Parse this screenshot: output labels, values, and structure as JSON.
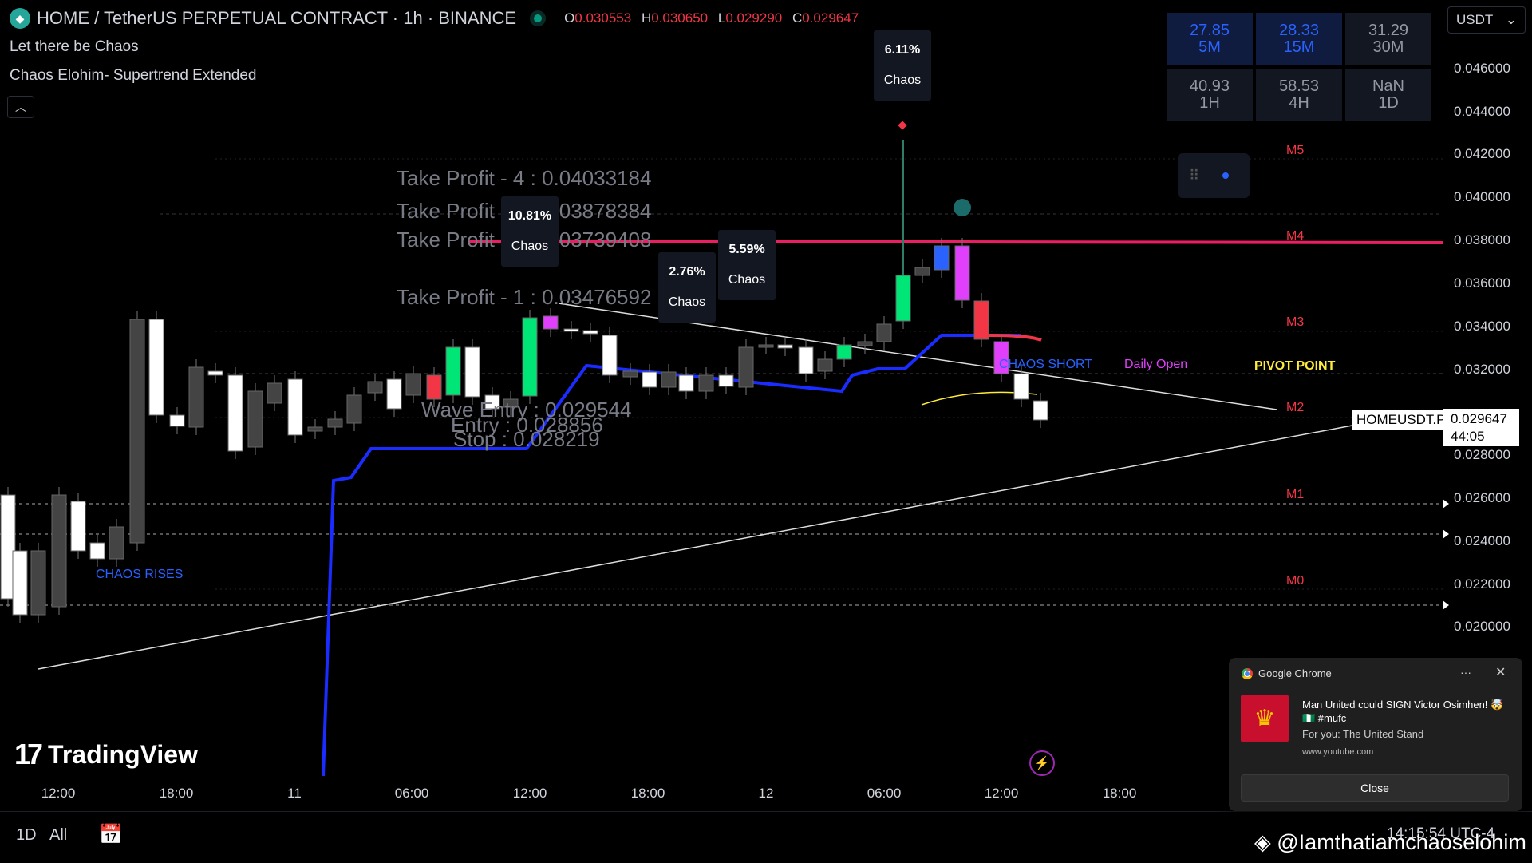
{
  "header": {
    "symbol_title": "HOME / TetherUS PERPETUAL CONTRACT · 1h · BINANCE",
    "ohlc": {
      "o_label": "O",
      "o": "0.030553",
      "h_label": "H",
      "h": "0.030650",
      "l_label": "L",
      "l": "0.029290",
      "c_label": "C",
      "c": "0.029647"
    }
  },
  "indicators": [
    "Let there be Chaos",
    "Chaos Elohim- Supertrend Extended"
  ],
  "currency": "USDT",
  "tf_table": [
    {
      "val": "27.85",
      "tf": "5M"
    },
    {
      "val": "28.33",
      "tf": "15M"
    },
    {
      "val": "31.29",
      "tf": "30M"
    },
    {
      "val": "40.93",
      "tf": "1H"
    },
    {
      "val": "58.53",
      "tf": "4H"
    },
    {
      "val": "NaN",
      "tf": "1D"
    }
  ],
  "y_axis": [
    "0.046000",
    "0.044000",
    "0.042000",
    "0.040000",
    "0.038000",
    "0.036000",
    "0.034000",
    "0.032000",
    "0.028000",
    "0.026000",
    "0.024000",
    "0.022000",
    "0.020000"
  ],
  "price_tag": {
    "symbol": "HOMEUSDT.P",
    "price": "0.029647",
    "countdown": "44:05"
  },
  "x_axis": [
    "12:00",
    "18:00",
    "11",
    "06:00",
    "12:00",
    "18:00",
    "12",
    "06:00",
    "12:00",
    "18:00"
  ],
  "take_profits": [
    "Take Profit - 4 : 0.04033184",
    "Take Profit - 3 : 0.03878384",
    "Take Profit - 2 : 0.03739408",
    "Take Profit - 1 : 0.03476592"
  ],
  "entries": [
    "Wave Entry : 0.029544",
    "Entry : 0.028856",
    "Stop : 0.028219"
  ],
  "bubbles": [
    {
      "pct": "10.81%",
      "label": "Chaos"
    },
    {
      "pct": "2.76%",
      "label": "Chaos"
    },
    {
      "pct": "5.59%",
      "label": "Chaos"
    },
    {
      "pct": "6.11%",
      "label": "Chaos"
    }
  ],
  "levels": [
    "M5",
    "M4",
    "M3",
    "M2",
    "M1",
    "M0"
  ],
  "labels": {
    "chaos_short": "CHAOS SHORT",
    "daily_open": "Daily Open",
    "pivot": "PIVOT POINT",
    "chaos_rises": "CHAOS RISES"
  },
  "colors": {
    "bull": "#00e676",
    "bear": "#f23645",
    "supertrend": "#1a2cff",
    "m4": "#e91e63",
    "pivot": "#ffeb3b",
    "magenta": "#e040fb"
  },
  "brand": "TradingView",
  "toolbar": {
    "range_1d": "1D",
    "range_all": "All"
  },
  "clock": "14:15:54 UTC-4",
  "watermark": "@Iamthatiamchaoselohim",
  "notification": {
    "app": "Google Chrome",
    "title": "Man United could SIGN Victor Osimhen! 🤯🇳🇬 #mufc",
    "subtitle": "For you: The United Stand",
    "url": "www.youtube.com",
    "close_label": "Close"
  }
}
